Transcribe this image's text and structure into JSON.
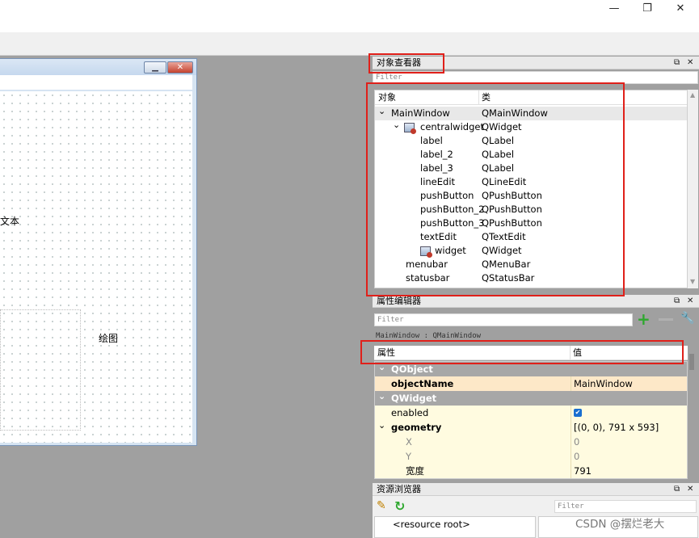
{
  "window_controls": {
    "minimize": "—",
    "maximize": "❐",
    "close": "✕"
  },
  "form": {
    "text_label": "文本",
    "draw_label": "绘图"
  },
  "object_inspector": {
    "title": "对象查看器",
    "filter_placeholder": "Filter",
    "columns": [
      "对象",
      "类"
    ],
    "rows": [
      {
        "name": "MainWindow",
        "class": "QMainWindow",
        "level": 0,
        "expander": "⌄",
        "icon": ""
      },
      {
        "name": "centralwidget",
        "class": "QWidget",
        "level": 1,
        "expander": "⌄",
        "icon": "widget-icon"
      },
      {
        "name": "label",
        "class": "QLabel",
        "level": 2,
        "expander": "",
        "icon": ""
      },
      {
        "name": "label_2",
        "class": "QLabel",
        "level": 2,
        "expander": "",
        "icon": ""
      },
      {
        "name": "label_3",
        "class": "QLabel",
        "level": 2,
        "expander": "",
        "icon": ""
      },
      {
        "name": "lineEdit",
        "class": "QLineEdit",
        "level": 2,
        "expander": "",
        "icon": ""
      },
      {
        "name": "pushButton",
        "class": "QPushButton",
        "level": 2,
        "expander": "",
        "icon": ""
      },
      {
        "name": "pushButton_2",
        "class": "QPushButton",
        "level": 2,
        "expander": "",
        "icon": ""
      },
      {
        "name": "pushButton_3",
        "class": "QPushButton",
        "level": 2,
        "expander": "",
        "icon": ""
      },
      {
        "name": "textEdit",
        "class": "QTextEdit",
        "level": 2,
        "expander": "",
        "icon": ""
      },
      {
        "name": "widget",
        "class": "QWidget",
        "level": 2,
        "expander": "",
        "icon": "widget-icon"
      },
      {
        "name": "menubar",
        "class": "QMenuBar",
        "level": 1,
        "expander": "",
        "icon": ""
      },
      {
        "name": "statusbar",
        "class": "QStatusBar",
        "level": 1,
        "expander": "",
        "icon": ""
      }
    ]
  },
  "property_editor": {
    "title": "属性编辑器",
    "filter_placeholder": "Filter",
    "context": "MainWindow : QMainWindow",
    "columns": [
      "属性",
      "值"
    ],
    "rows": [
      {
        "type": "group",
        "name": "QObject",
        "value": ""
      },
      {
        "type": "prop",
        "name": "objectName",
        "value": "MainWindow",
        "bold": true,
        "bg": "#fde8c8"
      },
      {
        "type": "group",
        "name": "QWidget",
        "value": ""
      },
      {
        "type": "prop",
        "name": "enabled",
        "value": "✔",
        "bold": false,
        "bg": "#fffbe0"
      },
      {
        "type": "prop",
        "name": "geometry",
        "value": "[(0, 0), 791 x 593]",
        "bold": true,
        "bg": "#fffbe0",
        "expander": "⌄"
      },
      {
        "type": "sub",
        "name": "X",
        "value": "0",
        "bold": false,
        "bg": "#fffbe0"
      },
      {
        "type": "sub",
        "name": "Y",
        "value": "0",
        "bold": false,
        "bg": "#fffbe0"
      },
      {
        "type": "prop2",
        "name": "宽度",
        "value": "791",
        "bold": false,
        "bg": "#fffbe0"
      }
    ]
  },
  "resource_browser": {
    "title": "资源浏览器",
    "filter_placeholder": "Filter",
    "root": "<resource root>"
  },
  "dock_buttons": {
    "float": "⧉",
    "close": "✕"
  },
  "watermark": "CSDN @摆烂老大",
  "colors": {
    "highlight": "#e0201a",
    "group_row": "#a7a7a7",
    "property_bg": "#fffbe0"
  }
}
